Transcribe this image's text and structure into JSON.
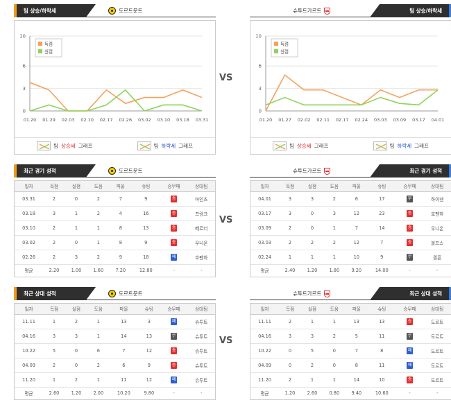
{
  "vs_label": "VS",
  "headers": {
    "trend": "팀 상승/하락세",
    "recent": "최근 경기 성적",
    "h2h": "최근 상대 성적"
  },
  "teams": {
    "left": "도르트문트",
    "right": "슈투트가르트"
  },
  "legend": {
    "goals": "득점",
    "conceded": "실점",
    "graph": "그래프",
    "team": "팀",
    "up": "상승세",
    "down": "하락세"
  },
  "colors": {
    "goals": "#f5a05a",
    "conceded": "#8dd35a",
    "accent_left": "#f29a1a",
    "accent_right": "#3b7dd8"
  },
  "columns": [
    "일자",
    "득점",
    "실점",
    "도움",
    "파울",
    "슈팅",
    "승무패",
    "상대팀"
  ],
  "chart_data": [
    {
      "type": "line",
      "x": [
        "01.20",
        "01.29",
        "02.03",
        "02.10",
        "02.17",
        "02.26",
        "03.02",
        "03.10",
        "03.18",
        "03.31"
      ],
      "series": [
        {
          "name": "득점",
          "values": [
            3.8,
            2.8,
            0,
            0,
            2.8,
            1.0,
            1.8,
            1.8,
            2.8,
            1.8
          ]
        },
        {
          "name": "실점",
          "values": [
            0,
            0.8,
            0,
            0,
            0.8,
            2.8,
            0,
            0.8,
            0.8,
            0
          ]
        }
      ],
      "ylim": [
        0,
        10
      ],
      "yticks": [
        0,
        3,
        6,
        10
      ]
    },
    {
      "type": "line",
      "x": [
        "01.20",
        "01.27",
        "02.02",
        "02.11",
        "02.17",
        "02.24",
        "03.03",
        "03.09",
        "03.17",
        "04.01"
      ],
      "series": [
        {
          "name": "득점",
          "values": [
            0,
            4.8,
            2.8,
            2.8,
            1.8,
            0.8,
            2.8,
            1.8,
            2.8,
            2.8
          ]
        },
        {
          "name": "실점",
          "values": [
            0.8,
            1.8,
            0.8,
            0.8,
            0.8,
            0.8,
            1.8,
            1.0,
            0.8,
            2.8
          ]
        }
      ],
      "ylim": [
        0,
        10
      ],
      "yticks": [
        0,
        3,
        6,
        10
      ]
    }
  ],
  "recent": {
    "left": {
      "rows": [
        [
          "03.31",
          "2",
          "0",
          "2",
          "7",
          "9",
          "승",
          "마인츠"
        ],
        [
          "03.18",
          "3",
          "1",
          "2",
          "4",
          "16",
          "승",
          "프랑크"
        ],
        [
          "03.10",
          "2",
          "1",
          "1",
          "8",
          "13",
          "승",
          "베르더"
        ],
        [
          "03.02",
          "2",
          "0",
          "1",
          "8",
          "9",
          "승",
          "우니온"
        ],
        [
          "02.26",
          "2",
          "3",
          "2",
          "9",
          "18",
          "패",
          "호펜하"
        ]
      ],
      "avg": [
        "평균",
        "2.20",
        "1.00",
        "1.60",
        "7.20",
        "12.80",
        "-",
        "-"
      ]
    },
    "right": {
      "rows": [
        [
          "04.01",
          "3",
          "3",
          "2",
          "6",
          "17",
          "무",
          "하이덴"
        ],
        [
          "03.17",
          "3",
          "0",
          "3",
          "12",
          "23",
          "승",
          "호펜하"
        ],
        [
          "03.09",
          "2",
          "0",
          "1",
          "7",
          "14",
          "승",
          "우니온"
        ],
        [
          "03.03",
          "2",
          "2",
          "2",
          "12",
          "7",
          "승",
          "볼프스"
        ],
        [
          "02.24",
          "1",
          "1",
          "1",
          "10",
          "9",
          "무",
          "쾰른"
        ]
      ],
      "avg": [
        "평균",
        "2.40",
        "1.20",
        "1.80",
        "9.20",
        "14.00",
        "-",
        "-"
      ]
    }
  },
  "h2h": {
    "left": {
      "rows": [
        [
          "11.11",
          "1",
          "2",
          "1",
          "13",
          "3",
          "패",
          "슈투트"
        ],
        [
          "04.16",
          "3",
          "3",
          "1",
          "14",
          "13",
          "무",
          "슈투트"
        ],
        [
          "10.22",
          "5",
          "0",
          "6",
          "7",
          "12",
          "승",
          "슈투트"
        ],
        [
          "04.09",
          "2",
          "0",
          "2",
          "6",
          "9",
          "승",
          "슈투트"
        ],
        [
          "11.20",
          "1",
          "2",
          "1",
          "11",
          "12",
          "패",
          "슈투트"
        ]
      ],
      "avg": [
        "평균",
        "2.60",
        "1.20",
        "2.00",
        "10.20",
        "9.80",
        "-",
        "-"
      ]
    },
    "right": {
      "rows": [
        [
          "11.11",
          "2",
          "1",
          "1",
          "13",
          "13",
          "승",
          "도르트"
        ],
        [
          "04.16",
          "3",
          "3",
          "2",
          "5",
          "11",
          "무",
          "도르트"
        ],
        [
          "10.22",
          "0",
          "5",
          "0",
          "7",
          "8",
          "패",
          "도르트"
        ],
        [
          "04.09",
          "0",
          "2",
          "0",
          "8",
          "11",
          "패",
          "도르트"
        ],
        [
          "11.20",
          "2",
          "1",
          "1",
          "14",
          "10",
          "승",
          "도르트"
        ]
      ],
      "avg": [
        "평균",
        "1.20",
        "2.60",
        "0.80",
        "9.40",
        "10.60",
        "-",
        "-"
      ]
    }
  }
}
